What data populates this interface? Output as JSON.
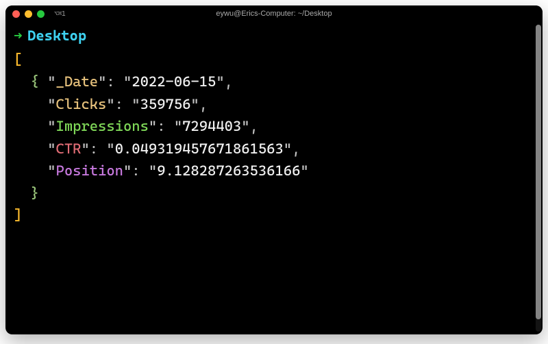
{
  "window": {
    "title": "eywu@Erics-Computer: ~/Desktop",
    "tab_indicator": "⌥⌘1"
  },
  "prompt": {
    "arrow": "➜",
    "cwd": "Desktop"
  },
  "output": {
    "open_bracket": "[",
    "close_bracket": "]",
    "open_brace": "{",
    "close_brace": "}",
    "comma": ",",
    "colon_sp": ": ",
    "q": "\"",
    "entries": [
      {
        "key": "_Date",
        "value": "2022-06-15"
      },
      {
        "key": "Clicks",
        "value": "359756"
      },
      {
        "key": "Impressions",
        "value": "7294403"
      },
      {
        "key": "CTR",
        "value": "0.049319457671861563"
      },
      {
        "key": "Position",
        "value": "9.128287263536166"
      }
    ]
  },
  "colors": {
    "bracket": "#ffbd2e",
    "brace": "#98c379",
    "key_row0": "#e5c07b",
    "key_row1": "#e5c07b",
    "key_row2": "#7fd858",
    "key_row3": "#e06c75",
    "key_row4": "#c678dd",
    "string": "#f0f0f0"
  }
}
